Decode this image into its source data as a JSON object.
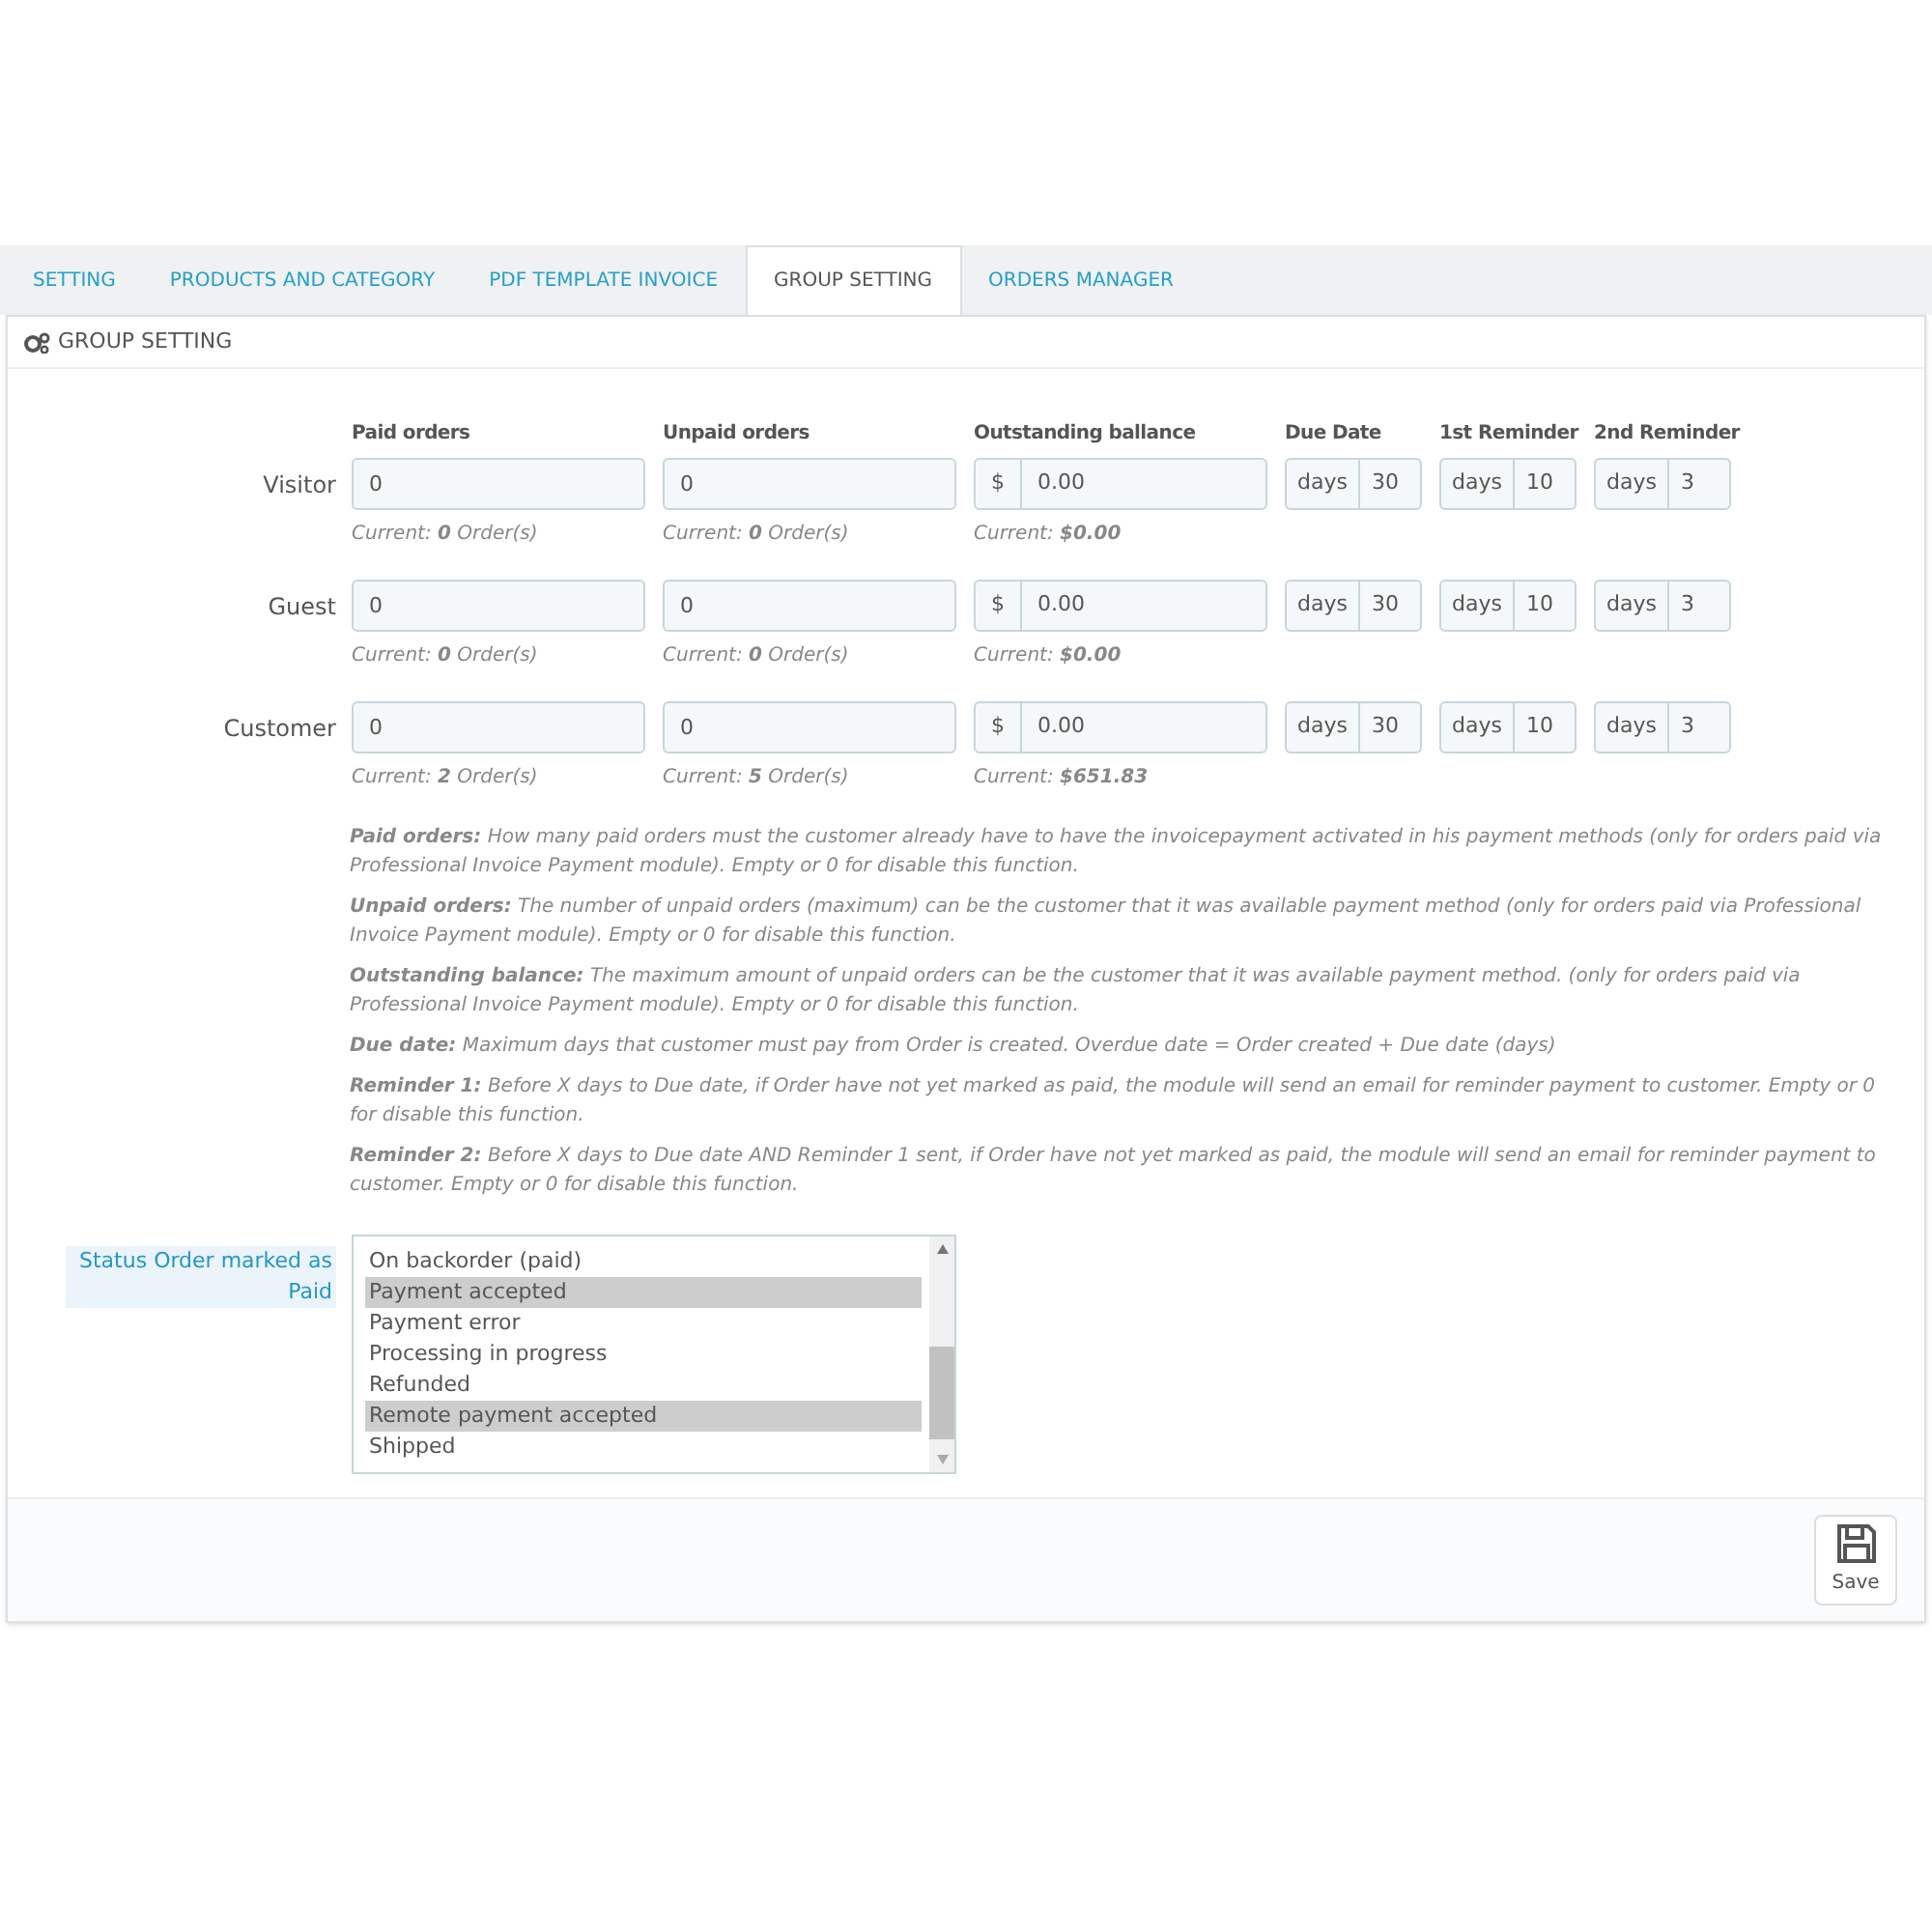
{
  "tabs": [
    {
      "label": "SETTING",
      "selected": false
    },
    {
      "label": "PRODUCTS AND CATEGORY",
      "selected": false
    },
    {
      "label": "PDF TEMPLATE INVOICE",
      "selected": false
    },
    {
      "label": "GROUP SETTING",
      "selected": true
    },
    {
      "label": "ORDERS MANAGER",
      "selected": false
    }
  ],
  "panel": {
    "title": "GROUP SETTING"
  },
  "columns": [
    "Paid orders",
    "Unpaid orders",
    "Outstanding ballance",
    "Due Date",
    "1st Reminder",
    "2nd Reminder"
  ],
  "groups": [
    {
      "name": "Visitor",
      "paid": "0",
      "unpaid": "0",
      "currency": "$",
      "balance": "0.00",
      "due_unit": "days",
      "due": "30",
      "r1_unit": "days",
      "r1": "10",
      "r2_unit": "days",
      "r2": "3",
      "paid_current": "Current: **0** Order(s)",
      "unpaid_current": "Current: **0** Order(s)",
      "balance_current": "Current: **$0.00**"
    },
    {
      "name": "Guest",
      "paid": "0",
      "unpaid": "0",
      "currency": "$",
      "balance": "0.00",
      "due_unit": "days",
      "due": "30",
      "r1_unit": "days",
      "r1": "10",
      "r2_unit": "days",
      "r2": "3",
      "paid_current": "Current: **0** Order(s)",
      "unpaid_current": "Current: **0** Order(s)",
      "balance_current": "Current: **$0.00**"
    },
    {
      "name": "Customer",
      "paid": "0",
      "unpaid": "0",
      "currency": "$",
      "balance": "0.00",
      "due_unit": "days",
      "due": "30",
      "r1_unit": "days",
      "r1": "10",
      "r2_unit": "days",
      "r2": "3",
      "paid_current": "Current: **2** Order(s)",
      "unpaid_current": "Current: **5** Order(s)",
      "balance_current": "Current: **$651.83**"
    }
  ],
  "help": [
    "**Paid orders:** How many paid orders must the customer already have to have the invoicepayment activated in his payment methods (only for orders paid via Professional Invoice Payment module). Empty or 0 for disable this function.",
    "**Unpaid orders:** The number of unpaid orders (maximum) can be the customer that it was available payment method (only for orders paid via Professional Invoice Payment module). Empty or 0 for disable this function.",
    "**Outstanding balance:** The maximum amount of unpaid orders can be the customer that it was available payment method. (only for orders paid via Professional Invoice Payment module). Empty or 0 for disable this function.",
    "**Due date:** Maximum days that customer must pay from Order is created. Overdue date = Order created + Due date (days)",
    "**Reminder 1:** Before X days to Due date, if Order have not yet marked as paid, the module will send an email for reminder payment to customer. Empty or 0 for disable this function.",
    "**Reminder 2:** Before X days to Due date AND Reminder 1 sent, if Order have not yet marked as paid, the module will send an email for reminder payment to customer. Empty or 0 for disable this function."
  ],
  "status_field": {
    "label": "Status Order marked as Paid",
    "options": [
      {
        "label": "On backorder (paid)",
        "selected": false
      },
      {
        "label": "Payment accepted",
        "selected": true
      },
      {
        "label": "Payment error",
        "selected": false
      },
      {
        "label": "Processing in progress",
        "selected": false
      },
      {
        "label": "Refunded",
        "selected": false
      },
      {
        "label": "Remote payment accepted",
        "selected": true
      },
      {
        "label": "Shipped",
        "selected": false
      }
    ]
  },
  "save_button": {
    "label": "Save"
  }
}
